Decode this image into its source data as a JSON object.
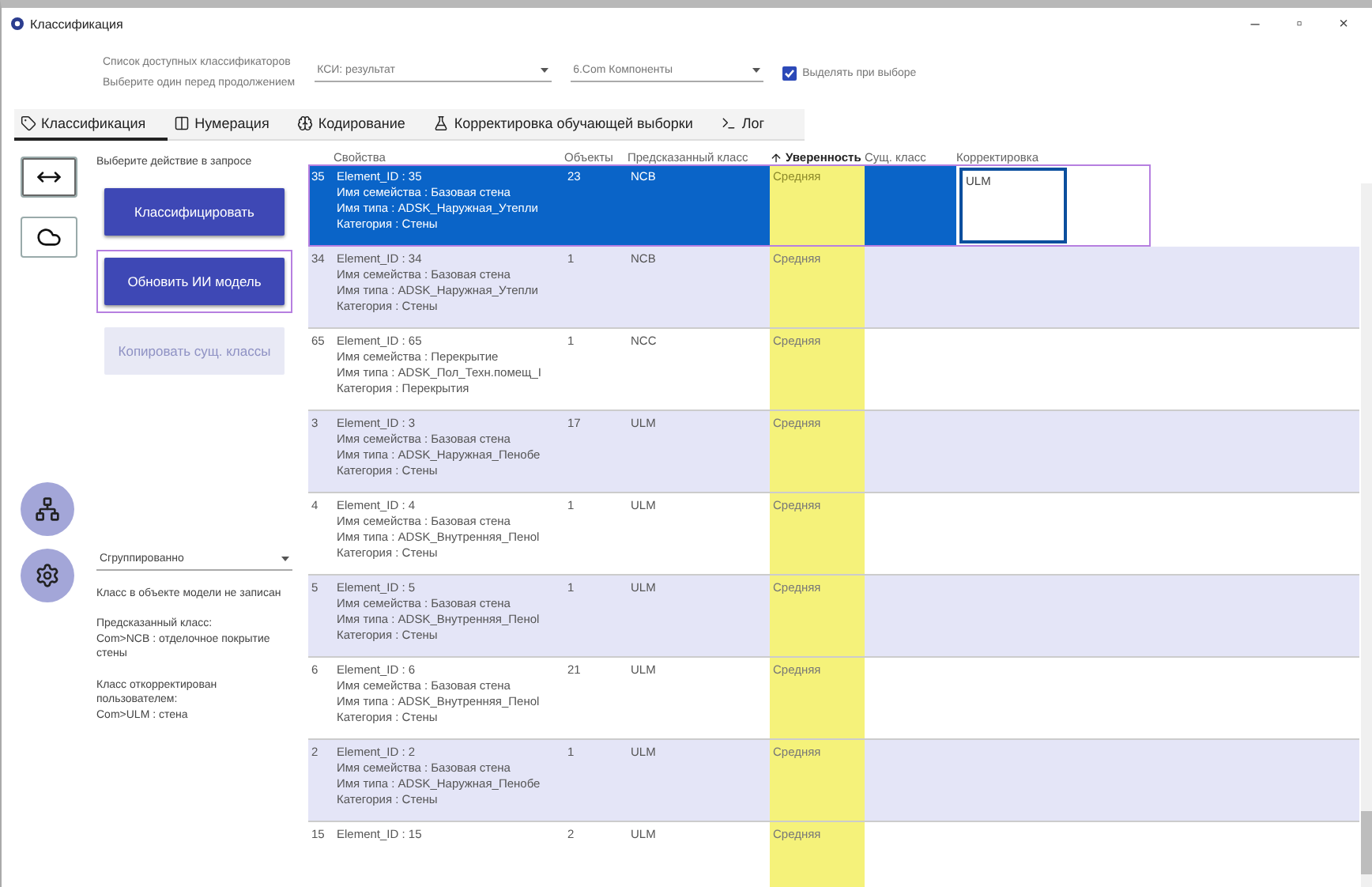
{
  "window": {
    "title": "Классификация",
    "controls": [
      "–",
      "▫",
      "×"
    ]
  },
  "header": {
    "hint_lines": [
      "Список доступных классификаторов",
      "Выберите один перед продолжением"
    ],
    "classifier": {
      "value": "КСИ: результат"
    },
    "component": {
      "value": "6.Com Компоненты"
    },
    "highlight_option": {
      "label": "Выделять при выборе",
      "checked": true
    }
  },
  "tabs": [
    {
      "label": "Классификация",
      "selected": true
    },
    {
      "label": "Нумерация",
      "selected": false
    },
    {
      "label": "Кодирование",
      "selected": false
    },
    {
      "label": "Корректировка обучающей выборки",
      "selected": false
    },
    {
      "label": "Лог",
      "selected": false
    }
  ],
  "side_tools": [
    {
      "selected": true
    },
    {
      "selected": false
    }
  ],
  "actions": {
    "title": "Выберите действие в запросе",
    "buttons": [
      {
        "label": "Классифицировать",
        "disabled": false,
        "highlighted": false
      },
      {
        "label": "Обновить ИИ модель",
        "disabled": false,
        "highlighted": true
      },
      {
        "label": "Копировать сущ. классы",
        "disabled": true,
        "highlighted": false
      }
    ]
  },
  "grouping": {
    "value": "Сгруппированно"
  },
  "info": [
    "Класс в объекте модели не записан",
    "Предсказанный класс:\nCom>NCB : отделочное покрытие стены",
    "Класс откорректирован пользователем:\nCom>ULM : стена"
  ],
  "table": {
    "columns": [
      {
        "label": "Свойства",
        "sorted": false
      },
      {
        "label": "Объекты",
        "sorted": false
      },
      {
        "label": "Предсказанный класс",
        "sorted": false
      },
      {
        "label": "Уверенность",
        "sorted": true
      },
      {
        "label": "Сущ. класс",
        "sorted": false
      },
      {
        "label": "Корректировка",
        "sorted": false
      }
    ],
    "rows": [
      {
        "index": "35",
        "lines": [
          "Element_ID : 35",
          "Имя семейства : Базовая стена",
          "Имя типа : ADSK_Наружная_Утепли",
          "Категория : Стены"
        ],
        "objects": "23",
        "predicted": "NCB",
        "confidence": "Средняя",
        "correction": "ULM",
        "selected": true,
        "highlighted": true
      },
      {
        "index": "34",
        "lines": [
          "Element_ID : 34",
          "Имя семейства : Базовая стена",
          "Имя типа : ADSK_Наружная_Утепли",
          "Категория : Стены"
        ],
        "objects": "1",
        "predicted": "NCB",
        "confidence": "Средняя",
        "selected": false,
        "highlighted": false
      },
      {
        "index": "65",
        "lines": [
          "Element_ID : 65",
          "Имя семейства : Перекрытие",
          "Имя типа : ADSK_Пол_Техн.помещ_I",
          "Категория : Перекрытия"
        ],
        "objects": "1",
        "predicted": "NCC",
        "confidence": "Средняя",
        "selected": false,
        "highlighted": false
      },
      {
        "index": "3",
        "lines": [
          "Element_ID : 3",
          "Имя семейства : Базовая стена",
          "Имя типа : ADSK_Наружная_Пенобе",
          "Категория : Стены"
        ],
        "objects": "17",
        "predicted": "ULM",
        "confidence": "Средняя",
        "selected": false,
        "highlighted": false
      },
      {
        "index": "4",
        "lines": [
          "Element_ID : 4",
          "Имя семейства : Базовая стена",
          "Имя типа : ADSK_Внутренняя_Пеноl",
          "Категория : Стены"
        ],
        "objects": "1",
        "predicted": "ULM",
        "confidence": "Средняя",
        "selected": false,
        "highlighted": false
      },
      {
        "index": "5",
        "lines": [
          "Element_ID : 5",
          "Имя семейства : Базовая стена",
          "Имя типа : ADSK_Внутренняя_Пеноl",
          "Категория : Стены"
        ],
        "objects": "1",
        "predicted": "ULM",
        "confidence": "Средняя",
        "selected": false,
        "highlighted": false
      },
      {
        "index": "6",
        "lines": [
          "Element_ID : 6",
          "Имя семейства : Базовая стена",
          "Имя типа : ADSK_Внутренняя_Пеноl",
          "Категория : Стены"
        ],
        "objects": "21",
        "predicted": "ULM",
        "confidence": "Средняя",
        "selected": false,
        "highlighted": false
      },
      {
        "index": "2",
        "lines": [
          "Element_ID : 2",
          "Имя семейства : Базовая стена",
          "Имя типа : ADSK_Наружная_Пенобе",
          "Категория : Стены"
        ],
        "objects": "1",
        "predicted": "ULM",
        "confidence": "Средняя",
        "selected": false,
        "highlighted": false
      },
      {
        "index": "15",
        "lines": [
          "Element_ID : 15"
        ],
        "objects": "2",
        "predicted": "ULM",
        "confidence": "Средняя",
        "selected": false,
        "highlighted": false
      }
    ]
  }
}
